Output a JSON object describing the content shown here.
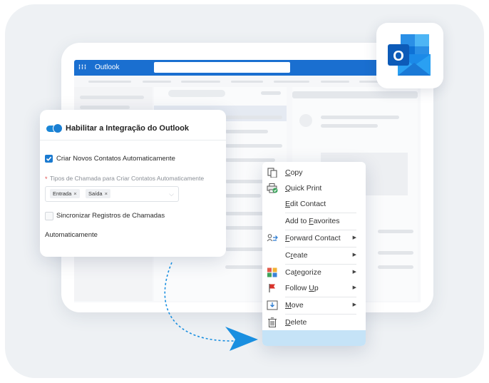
{
  "outlook_window": {
    "app_title": "Outlook",
    "waffle_icon": "waffle-icon",
    "brand_color": "#1a6fd0"
  },
  "logo": {
    "icon": "outlook-logo-icon"
  },
  "settings": {
    "title": "Habilitar a Integração do Outlook",
    "toggle_on": true,
    "create_contacts_label": "Criar Novos Contatos Automaticamente",
    "create_contacts_checked": true,
    "call_types_required_mark": "*",
    "call_types_label": "Tipos de Chamada para Criar Contatos Automaticamente",
    "call_types_selected": [
      {
        "label": "Entrada",
        "remove": "×"
      },
      {
        "label": "Saída",
        "remove": "×"
      }
    ],
    "call_types_chevron": "⌵",
    "sync_label": "Sincronizar Registros de Chamadas",
    "sync_label_cont": "Automaticamente",
    "sync_checked": false
  },
  "context_menu": {
    "items": [
      {
        "pre": "",
        "acc": "C",
        "post": "opy",
        "icon": "copy-icon",
        "submenu": false
      },
      {
        "pre": "",
        "acc": "Q",
        "post": "uick Print",
        "icon": "quick-print-icon",
        "submenu": false
      },
      {
        "pre": "",
        "acc": "E",
        "post": "dit Contact",
        "icon": "",
        "submenu": false
      },
      {
        "pre": "Add to ",
        "acc": "F",
        "post": "avorites",
        "icon": "",
        "submenu": false
      },
      {
        "pre": "",
        "acc": "F",
        "post": "orward Contact",
        "icon": "forward-contact-icon",
        "submenu": true,
        "arrow": "▶"
      },
      {
        "pre": "C",
        "acc": "r",
        "post": "eate",
        "icon": "",
        "submenu": true,
        "arrow": "▶"
      },
      {
        "pre": "Ca",
        "acc": "t",
        "post": "egorize",
        "icon": "categorize-icon",
        "submenu": true,
        "arrow": "▶"
      },
      {
        "pre": "Follow ",
        "acc": "U",
        "post": "p",
        "icon": "follow-up-flag-icon",
        "submenu": true,
        "arrow": "▶"
      },
      {
        "pre": "",
        "acc": "M",
        "post": "ove",
        "icon": "move-icon",
        "submenu": true,
        "arrow": "▶"
      },
      {
        "pre": "",
        "acc": "D",
        "post": "elete",
        "icon": "delete-icon",
        "submenu": false
      }
    ],
    "footer_color": "#c5e3f7"
  },
  "arrow": {
    "icon": "curved-arrow-icon",
    "color": "#1a8fe0"
  }
}
